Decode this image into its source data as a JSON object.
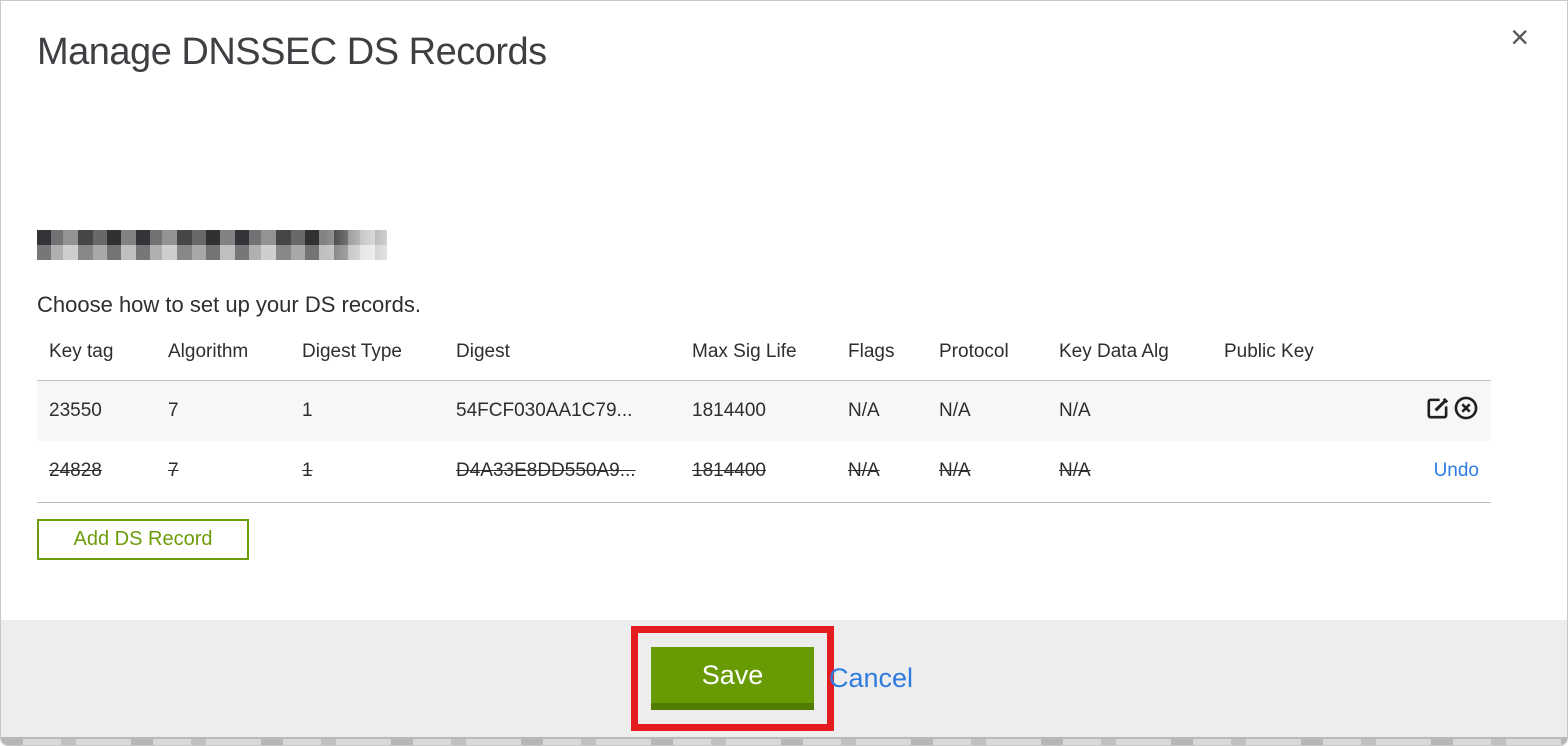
{
  "modal": {
    "title": "Manage DNSSEC DS Records",
    "close_label": "×"
  },
  "intro": {
    "instruction": "Choose how to set up your DS records."
  },
  "table": {
    "columns": {
      "key_tag": "Key tag",
      "algorithm": "Algorithm",
      "digest_type": "Digest Type",
      "digest": "Digest",
      "max_sig_life": "Max Sig Life",
      "flags": "Flags",
      "protocol": "Protocol",
      "key_data_alg": "Key Data Alg",
      "public_key": "Public Key"
    },
    "rows": [
      {
        "key_tag": "23550",
        "algorithm": "7",
        "digest_type": "1",
        "digest": "54FCF030AA1C79...",
        "max_sig_life": "1814400",
        "flags": "N/A",
        "protocol": "N/A",
        "key_data_alg": "N/A",
        "public_key": "",
        "state": "normal"
      },
      {
        "key_tag": "24828",
        "algorithm": "7",
        "digest_type": "1",
        "digest": "D4A33E8DD550A9...",
        "max_sig_life": "1814400",
        "flags": "N/A",
        "protocol": "N/A",
        "key_data_alg": "N/A",
        "public_key": "",
        "state": "deleted",
        "undo_label": "Undo"
      }
    ]
  },
  "buttons": {
    "add_ds_record": "Add DS Record",
    "save": "Save",
    "cancel": "Cancel"
  },
  "colors": {
    "accent_green": "#689b03",
    "accent_green_dark": "#527c04",
    "outline_green": "#6d9c09",
    "link_blue": "#2e7ce0",
    "annotation_red": "#e41b1f",
    "footer_gray": "#ededed",
    "row_stripe_gray": "#f7f7f7"
  }
}
